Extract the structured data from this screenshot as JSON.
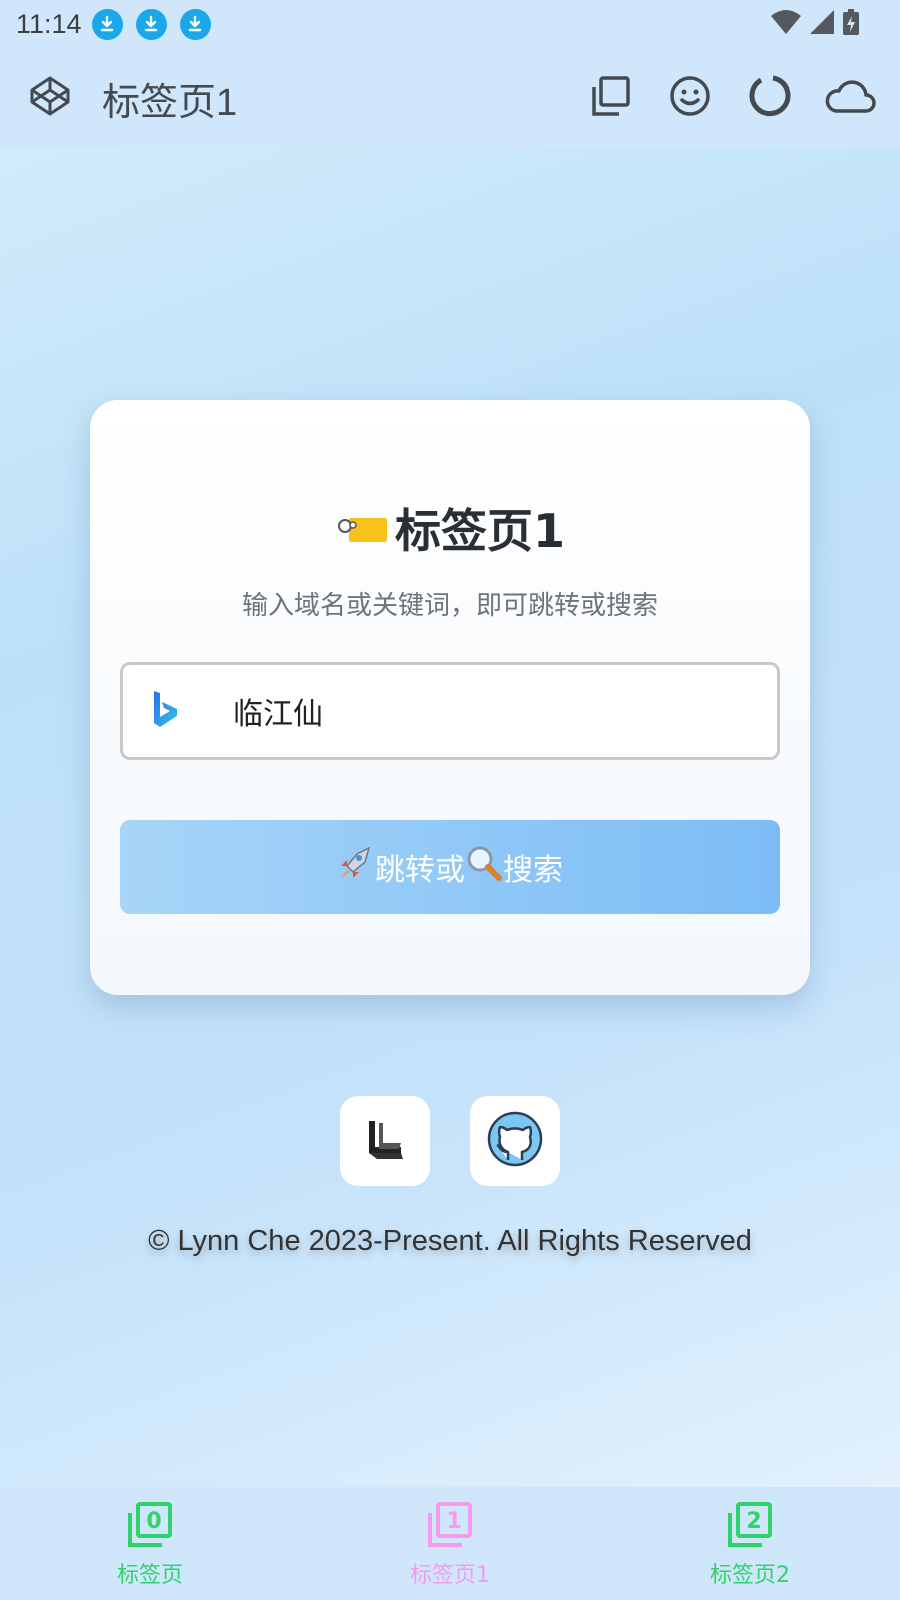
{
  "status_bar": {
    "time": "11:14",
    "notification_icons": [
      "download-icon",
      "download-icon",
      "download-icon"
    ],
    "right_icons": [
      "wifi-icon",
      "signal-icon",
      "battery-charging-icon"
    ]
  },
  "app_bar": {
    "logo_icon": "codepen-icon",
    "title": "标签页1",
    "actions": [
      "copy-icon",
      "smiley-icon",
      "loading-ring-icon",
      "cloud-icon"
    ]
  },
  "card": {
    "title": "标签页1",
    "title_icon": "tag-icon",
    "subtitle": "输入域名或关键词，即可跳转或搜索",
    "search": {
      "engine_icon": "bing-icon",
      "value": "临江仙"
    },
    "go_button": {
      "part1": "跳转或",
      "part2": "搜索",
      "icon1": "rocket-icon",
      "icon2": "magnifier-icon"
    }
  },
  "links": [
    "lynn-logo-icon",
    "github-icon"
  ],
  "footer": {
    "copyright": "© Lynn Che 2023-Present. All Rights Reserved"
  },
  "bottom_nav": {
    "items": [
      {
        "label": "标签页",
        "digit": "0",
        "color": "#2fd26b"
      },
      {
        "label": "标签页1",
        "digit": "1",
        "color": "#f59af0"
      },
      {
        "label": "标签页2",
        "digit": "2",
        "color": "#2fd26b"
      }
    ]
  },
  "colors": {
    "accent_blue": "#1aa8e8",
    "button_gradient_start": "#a7d5f8",
    "button_gradient_end": "#7cbcf6"
  }
}
